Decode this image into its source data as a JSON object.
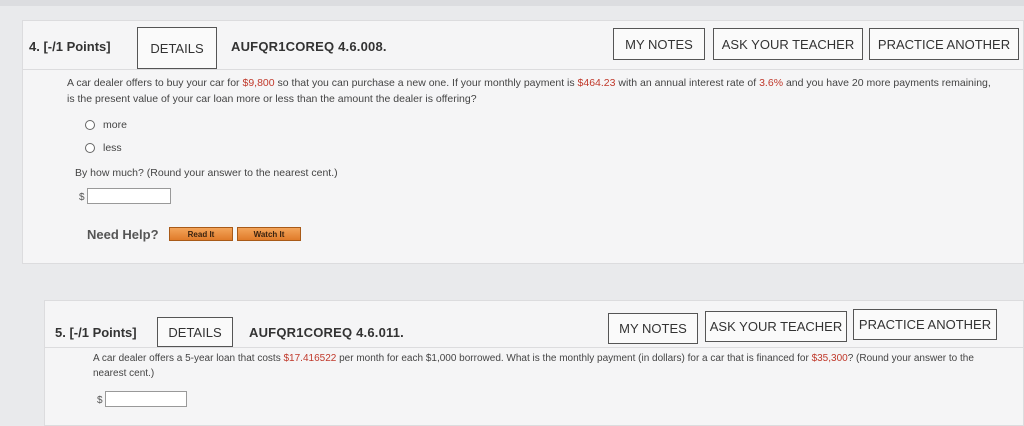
{
  "q1": {
    "number": "4. [-/1 Points]",
    "details_label": "DETAILS",
    "code": "AUFQR1COREQ 4.6.008.",
    "my_notes_label": "MY NOTES",
    "ask_teacher_label": "ASK YOUR TEACHER",
    "practice_label": "PRACTICE ANOTHER",
    "text": {
      "p1": "A car dealer offers to buy your car for ",
      "v1": "$9,800",
      "p2": " so that you can purchase a new one. If your monthly payment is ",
      "v2": "$464.23",
      "p3": " with an annual interest rate of ",
      "v3": "3.6%",
      "p4": " and you have 20 more payments remaining, is the present value of your car loan more or less than the amount the dealer is offering?"
    },
    "options": [
      "more",
      "less"
    ],
    "followup": "By how much? (Round your answer to the nearest cent.)",
    "currency": "$",
    "answer_value": "",
    "need_help": "Need Help?",
    "read_it": "Read It",
    "watch_it": "Watch It"
  },
  "q2": {
    "number": "5. [-/1 Points]",
    "details_label": "DETAILS",
    "code": "AUFQR1COREQ 4.6.011.",
    "my_notes_label": "MY NOTES",
    "ask_teacher_label": "ASK YOUR TEACHER",
    "practice_label": "PRACTICE ANOTHER",
    "text": {
      "p1": "A car dealer offers a 5-year loan that costs ",
      "v1": "$17.416522",
      "p2": " per month for each $1,000 borrowed. What is the monthly payment (in dollars) for a car that is financed for ",
      "v2": "$35,300",
      "p3": "? (Round your answer to the nearest cent.)"
    },
    "currency": "$",
    "answer_value": ""
  },
  "colors": {
    "accent_red": "#c0392b",
    "help_button": "#e88d3c",
    "card_bg": "#f5f5f6"
  }
}
